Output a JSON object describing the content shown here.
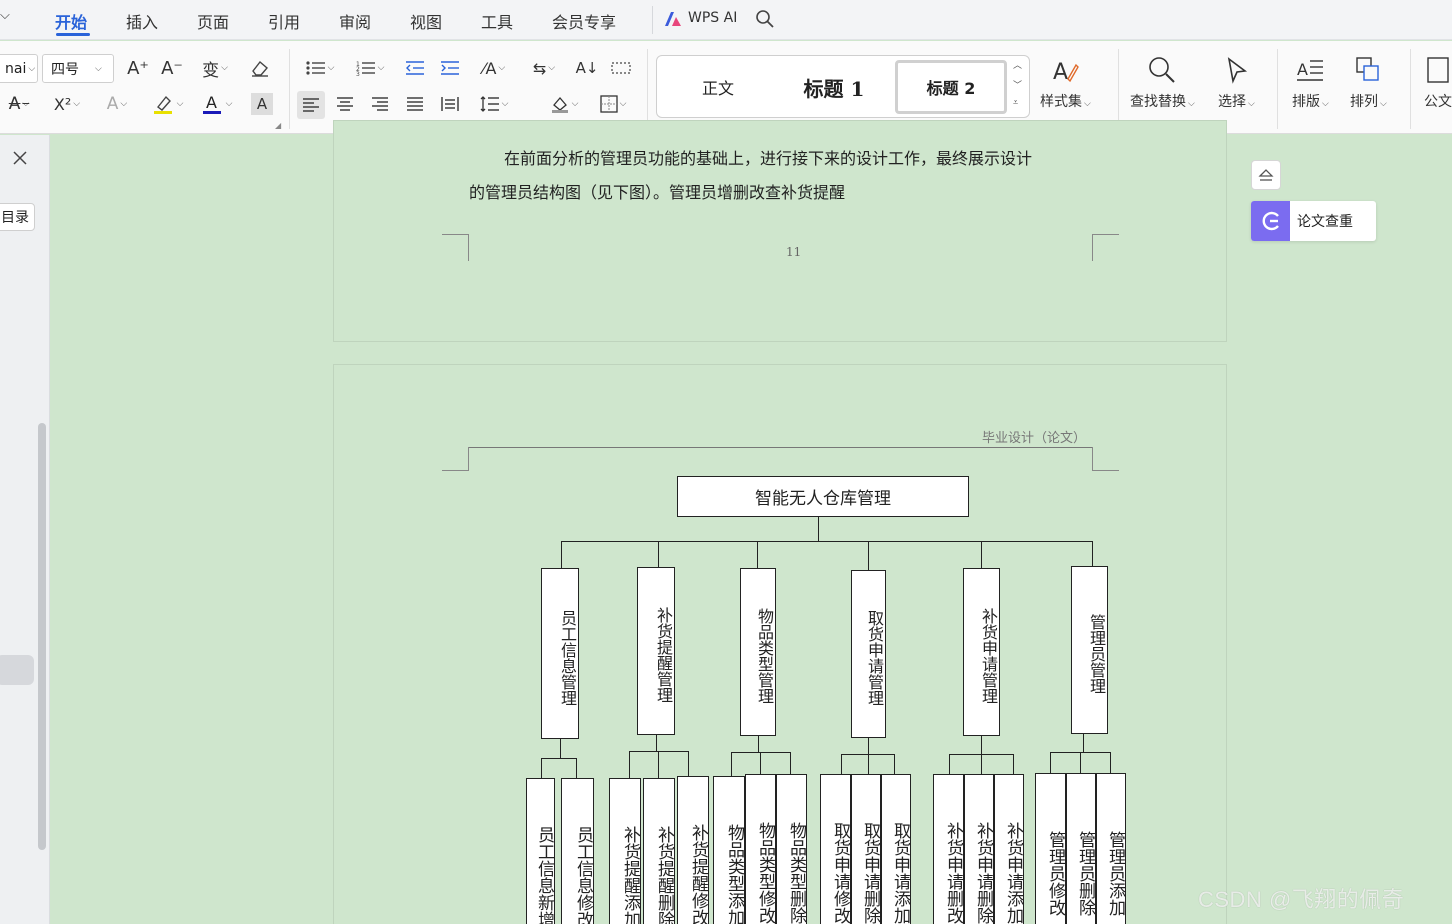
{
  "menu": {
    "tabs": [
      "开始",
      "插入",
      "页面",
      "引用",
      "审阅",
      "视图",
      "工具",
      "会员专享"
    ],
    "wps_ai": "WPS AI",
    "colors": {
      "accent": "#2a63d9"
    }
  },
  "ribbon": {
    "font_name": "nai",
    "font_size": "四号",
    "styles": {
      "normal": "正文",
      "heading1": "标题 1",
      "heading2": "标题 2"
    },
    "style_set": "样式集",
    "find_replace": "查找替换",
    "select": "选择",
    "layout": "排版",
    "arrange": "排列",
    "official": "公文",
    "superscript": "X²",
    "char_a": "A"
  },
  "side": {
    "toc": "目录"
  },
  "right_panel": {
    "check_label": "论文查重"
  },
  "page1": {
    "line1": "在前面分析的管理员功能的基础上，进行接下来的设计工作，最终展示设计",
    "line2": "的管理员结构图（见下图）。管理员增删改查补货提醒",
    "page_number": "11"
  },
  "page2": {
    "header": "毕业设计（论文）"
  },
  "diagram": {
    "root": "智能无人仓库管理",
    "branches": [
      {
        "label": "员工信息管理",
        "leaves": [
          "员工信息新增",
          "员工信息修改"
        ]
      },
      {
        "label": "补货提醒管理",
        "leaves": [
          "补货提醒添加",
          "补货提醒删除",
          "补货提醒修改"
        ]
      },
      {
        "label": "物品类型管理",
        "leaves": [
          "物品类型添加",
          "物品类型修改",
          "物品类型删除"
        ]
      },
      {
        "label": "取货申请管理",
        "leaves": [
          "取货申请修改",
          "取货申请删除",
          "取货申请添加"
        ]
      },
      {
        "label": "补货申请管理",
        "leaves": [
          "补货申请删改",
          "补货申请删除",
          "补货申请添加"
        ]
      },
      {
        "label": "管理员管理",
        "leaves": [
          "管理员修改",
          "管理员删除",
          "管理员添加"
        ]
      }
    ]
  },
  "watermark": "CSDN @飞翔的佩奇"
}
